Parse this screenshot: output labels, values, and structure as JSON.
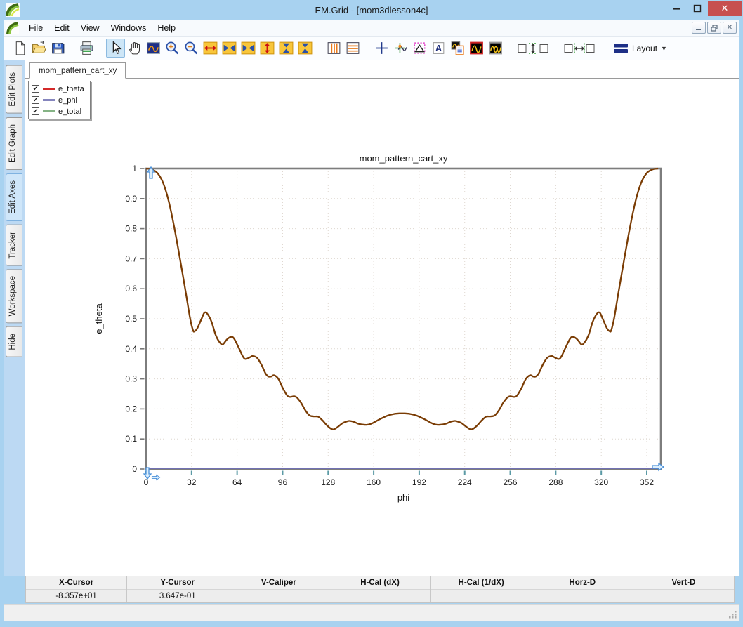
{
  "window": {
    "title": "EM.Grid - [mom3dlesson4c]",
    "controls": {
      "minimize": "–",
      "maximize": "❐",
      "close": "✕"
    }
  },
  "menu": {
    "items": [
      {
        "label": "File"
      },
      {
        "label": "Edit"
      },
      {
        "label": "View"
      },
      {
        "label": "Windows"
      },
      {
        "label": "Help"
      }
    ],
    "mdi_controls": {
      "minimize": "–",
      "restore": "❐",
      "close": "✕"
    }
  },
  "toolbar": {
    "items": [
      {
        "icon": "new-document-icon"
      },
      {
        "icon": "open-file-icon"
      },
      {
        "icon": "save-icon"
      },
      {
        "icon": "print-icon",
        "gap": true
      },
      {
        "icon": "select-pointer-icon",
        "gap": true,
        "selected": true
      },
      {
        "icon": "pan-hand-icon"
      },
      {
        "icon": "zoom-region-icon"
      },
      {
        "icon": "zoom-in-icon"
      },
      {
        "icon": "zoom-out-icon"
      },
      {
        "icon": "expand-horizontal-icon"
      },
      {
        "icon": "stretch-horizontal-icon"
      },
      {
        "icon": "compress-horizontal-icon"
      },
      {
        "icon": "expand-vertical-icon"
      },
      {
        "icon": "stretch-vertical-icon"
      },
      {
        "icon": "compress-vertical-icon"
      },
      {
        "icon": "vertical-stripes-icon",
        "gap": true
      },
      {
        "icon": "horizontal-stripes-icon"
      },
      {
        "icon": "crosshair-icon",
        "gap": true
      },
      {
        "icon": "tracker-icon"
      },
      {
        "icon": "shear-tool-icon"
      },
      {
        "icon": "text-annotation-icon"
      },
      {
        "icon": "plot-report-icon"
      },
      {
        "icon": "single-trace-icon"
      },
      {
        "icon": "multi-trace-icon"
      },
      {
        "icon": "vertical-spacing-icon",
        "gap": true,
        "wide": true
      },
      {
        "icon": "horizontal-spacing-icon",
        "gap": true,
        "wide": true
      }
    ],
    "layout_label": "Layout"
  },
  "side_tabs": {
    "items": [
      {
        "label": "Edit Plots",
        "selected": false
      },
      {
        "label": "Edit Graph",
        "selected": false
      },
      {
        "label": "Edit Axes",
        "selected": true
      },
      {
        "label": "Tracker",
        "selected": false
      },
      {
        "label": "Workspace",
        "selected": false
      },
      {
        "label": "Hide",
        "selected": false
      }
    ]
  },
  "document": {
    "tab_label": "mom_pattern_cart_xy"
  },
  "legend": {
    "entries": [
      {
        "label": "e_theta",
        "color": "#d42a2a",
        "checked": true
      },
      {
        "label": "e_phi",
        "color": "#8585bd",
        "checked": true
      },
      {
        "label": "e_total",
        "color": "#85b385",
        "checked": true
      }
    ]
  },
  "chart_data": {
    "type": "line",
    "title": "mom_pattern_cart_xy",
    "xlabel": "phi",
    "ylabel": "e_theta",
    "xlim": [
      0,
      362
    ],
    "ylim": [
      0,
      1
    ],
    "x_ticks": [
      0,
      32,
      64,
      96,
      128,
      160,
      192,
      224,
      256,
      288,
      320,
      352
    ],
    "y_ticks": [
      0,
      0.1,
      0.2,
      0.3,
      0.4,
      0.5,
      0.6,
      0.7,
      0.8,
      0.9,
      1
    ],
    "grid": "dotted",
    "legend_position": "floating top-left panel with checkboxes",
    "plotted_curve_color": "#7a3c04",
    "series": [
      {
        "name": "e_theta",
        "legend_color": "#d42a2a",
        "points": [
          [
            0,
            1.0
          ],
          [
            4,
            0.997
          ],
          [
            8,
            0.985
          ],
          [
            12,
            0.952
          ],
          [
            16,
            0.89
          ],
          [
            20,
            0.8
          ],
          [
            24,
            0.695
          ],
          [
            28,
            0.585
          ],
          [
            31,
            0.5
          ],
          [
            33,
            0.462
          ],
          [
            34,
            0.458
          ],
          [
            36,
            0.468
          ],
          [
            39,
            0.5
          ],
          [
            41,
            0.52
          ],
          [
            43,
            0.517
          ],
          [
            46,
            0.49
          ],
          [
            49,
            0.445
          ],
          [
            52,
            0.42
          ],
          [
            54,
            0.415
          ],
          [
            57,
            0.432
          ],
          [
            60,
            0.44
          ],
          [
            62,
            0.433
          ],
          [
            65,
            0.405
          ],
          [
            68,
            0.375
          ],
          [
            70,
            0.366
          ],
          [
            73,
            0.372
          ],
          [
            75,
            0.376
          ],
          [
            78,
            0.37
          ],
          [
            81,
            0.348
          ],
          [
            84,
            0.318
          ],
          [
            86,
            0.308
          ],
          [
            88,
            0.308
          ],
          [
            90,
            0.312
          ],
          [
            93,
            0.3
          ],
          [
            96,
            0.27
          ],
          [
            99,
            0.246
          ],
          [
            101,
            0.24
          ],
          [
            104,
            0.242
          ],
          [
            106,
            0.238
          ],
          [
            109,
            0.22
          ],
          [
            112,
            0.195
          ],
          [
            115,
            0.178
          ],
          [
            118,
            0.175
          ],
          [
            121,
            0.174
          ],
          [
            124,
            0.162
          ],
          [
            127,
            0.146
          ],
          [
            130,
            0.134
          ],
          [
            132,
            0.132
          ],
          [
            135,
            0.141
          ],
          [
            138,
            0.152
          ],
          [
            141,
            0.158
          ],
          [
            143,
            0.16
          ],
          [
            146,
            0.157
          ],
          [
            149,
            0.151
          ],
          [
            152,
            0.148
          ],
          [
            155,
            0.147
          ],
          [
            158,
            0.15
          ],
          [
            161,
            0.157
          ],
          [
            164,
            0.165
          ],
          [
            167,
            0.172
          ],
          [
            170,
            0.178
          ],
          [
            174,
            0.183
          ],
          [
            178,
            0.185
          ],
          [
            182,
            0.185
          ],
          [
            186,
            0.183
          ],
          [
            190,
            0.178
          ],
          [
            193,
            0.172
          ],
          [
            196,
            0.165
          ],
          [
            199,
            0.157
          ],
          [
            202,
            0.15
          ],
          [
            205,
            0.147
          ],
          [
            208,
            0.148
          ],
          [
            211,
            0.151
          ],
          [
            214,
            0.157
          ],
          [
            217,
            0.16
          ],
          [
            219,
            0.158
          ],
          [
            222,
            0.152
          ],
          [
            225,
            0.141
          ],
          [
            228,
            0.132
          ],
          [
            230,
            0.134
          ],
          [
            233,
            0.146
          ],
          [
            236,
            0.162
          ],
          [
            239,
            0.174
          ],
          [
            242,
            0.175
          ],
          [
            245,
            0.178
          ],
          [
            248,
            0.195
          ],
          [
            251,
            0.22
          ],
          [
            254,
            0.238
          ],
          [
            256,
            0.242
          ],
          [
            259,
            0.24
          ],
          [
            261,
            0.246
          ],
          [
            264,
            0.27
          ],
          [
            267,
            0.3
          ],
          [
            270,
            0.312
          ],
          [
            272,
            0.308
          ],
          [
            274,
            0.308
          ],
          [
            276,
            0.318
          ],
          [
            279,
            0.348
          ],
          [
            282,
            0.37
          ],
          [
            285,
            0.376
          ],
          [
            287,
            0.372
          ],
          [
            290,
            0.366
          ],
          [
            292,
            0.375
          ],
          [
            295,
            0.405
          ],
          [
            298,
            0.433
          ],
          [
            300,
            0.44
          ],
          [
            303,
            0.432
          ],
          [
            306,
            0.415
          ],
          [
            308,
            0.42
          ],
          [
            311,
            0.445
          ],
          [
            314,
            0.49
          ],
          [
            317,
            0.517
          ],
          [
            319,
            0.52
          ],
          [
            321,
            0.5
          ],
          [
            324,
            0.468
          ],
          [
            326,
            0.458
          ],
          [
            327,
            0.462
          ],
          [
            329,
            0.5
          ],
          [
            332,
            0.585
          ],
          [
            336,
            0.695
          ],
          [
            340,
            0.8
          ],
          [
            344,
            0.89
          ],
          [
            348,
            0.952
          ],
          [
            352,
            0.985
          ],
          [
            356,
            0.997
          ],
          [
            360,
            1.0
          ]
        ]
      },
      {
        "name": "e_phi",
        "legend_color": "#8585bd",
        "points": [
          [
            0,
            0
          ],
          [
            360,
            0
          ]
        ]
      },
      {
        "name": "e_total",
        "legend_color": "#85b385",
        "points_ref": "e_theta",
        "note": "overlaps e_theta exactly; combined stroke renders brown"
      }
    ]
  },
  "status_bar": {
    "columns": [
      {
        "label": "X-Cursor",
        "value": "-8.357e+01"
      },
      {
        "label": "Y-Cursor",
        "value": "3.647e-01"
      },
      {
        "label": "V-Caliper",
        "value": ""
      },
      {
        "label": "H-Cal (dX)",
        "value": ""
      },
      {
        "label": "H-Cal (1/dX)",
        "value": ""
      },
      {
        "label": "Horz-D",
        "value": ""
      },
      {
        "label": "Vert-D",
        "value": ""
      }
    ]
  }
}
